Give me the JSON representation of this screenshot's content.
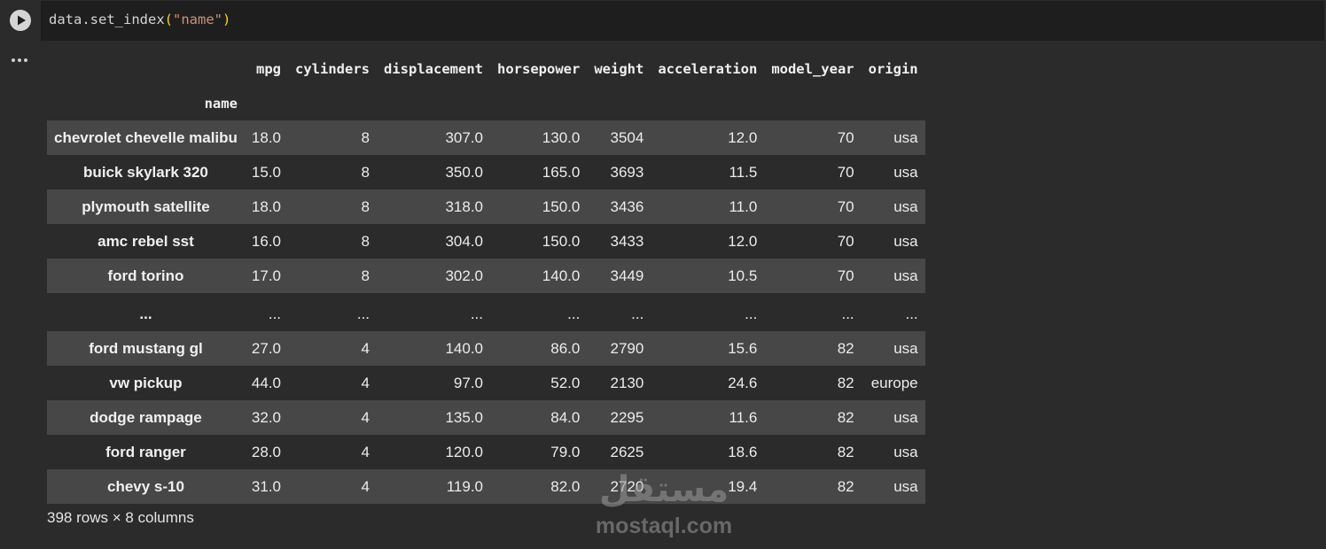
{
  "code": {
    "object": "data",
    "method": ".set_index",
    "open_paren": "(",
    "argument": "\"name\"",
    "close_paren": ")"
  },
  "table": {
    "index_name": "name",
    "columns": [
      "mpg",
      "cylinders",
      "displacement",
      "horsepower",
      "weight",
      "acceleration",
      "model_year",
      "origin"
    ],
    "rows": [
      {
        "name": "chevrolet chevelle malibu",
        "values": [
          "18.0",
          "8",
          "307.0",
          "130.0",
          "3504",
          "12.0",
          "70",
          "usa"
        ]
      },
      {
        "name": "buick skylark 320",
        "values": [
          "15.0",
          "8",
          "350.0",
          "165.0",
          "3693",
          "11.5",
          "70",
          "usa"
        ]
      },
      {
        "name": "plymouth satellite",
        "values": [
          "18.0",
          "8",
          "318.0",
          "150.0",
          "3436",
          "11.0",
          "70",
          "usa"
        ]
      },
      {
        "name": "amc rebel sst",
        "values": [
          "16.0",
          "8",
          "304.0",
          "150.0",
          "3433",
          "12.0",
          "70",
          "usa"
        ]
      },
      {
        "name": "ford torino",
        "values": [
          "17.0",
          "8",
          "302.0",
          "140.0",
          "3449",
          "10.5",
          "70",
          "usa"
        ]
      },
      {
        "name": "...",
        "values": [
          "...",
          "...",
          "...",
          "...",
          "...",
          "...",
          "...",
          "..."
        ]
      },
      {
        "name": "ford mustang gl",
        "values": [
          "27.0",
          "4",
          "140.0",
          "86.0",
          "2790",
          "15.6",
          "82",
          "usa"
        ]
      },
      {
        "name": "vw pickup",
        "values": [
          "44.0",
          "4",
          "97.0",
          "52.0",
          "2130",
          "24.6",
          "82",
          "europe"
        ]
      },
      {
        "name": "dodge rampage",
        "values": [
          "32.0",
          "4",
          "135.0",
          "84.0",
          "2295",
          "11.6",
          "82",
          "usa"
        ]
      },
      {
        "name": "ford ranger",
        "values": [
          "28.0",
          "4",
          "120.0",
          "79.0",
          "2625",
          "18.6",
          "82",
          "usa"
        ]
      },
      {
        "name": "chevy s-10",
        "values": [
          "31.0",
          "4",
          "119.0",
          "82.0",
          "2720",
          "19.4",
          "82",
          "usa"
        ]
      }
    ]
  },
  "shape_note": "398 rows × 8 columns",
  "watermark": {
    "arabic": "مستقل",
    "latin": "mostaql.com"
  },
  "icons": {
    "run": "play-circle-icon",
    "output_menu": "more-horizontal-icon"
  },
  "colors": {
    "background": "#2b2b2b",
    "editor_background": "#1e1e1e",
    "striped_row": "#474747",
    "string_literal": "#ce9178",
    "bracket": "#ffd700"
  }
}
